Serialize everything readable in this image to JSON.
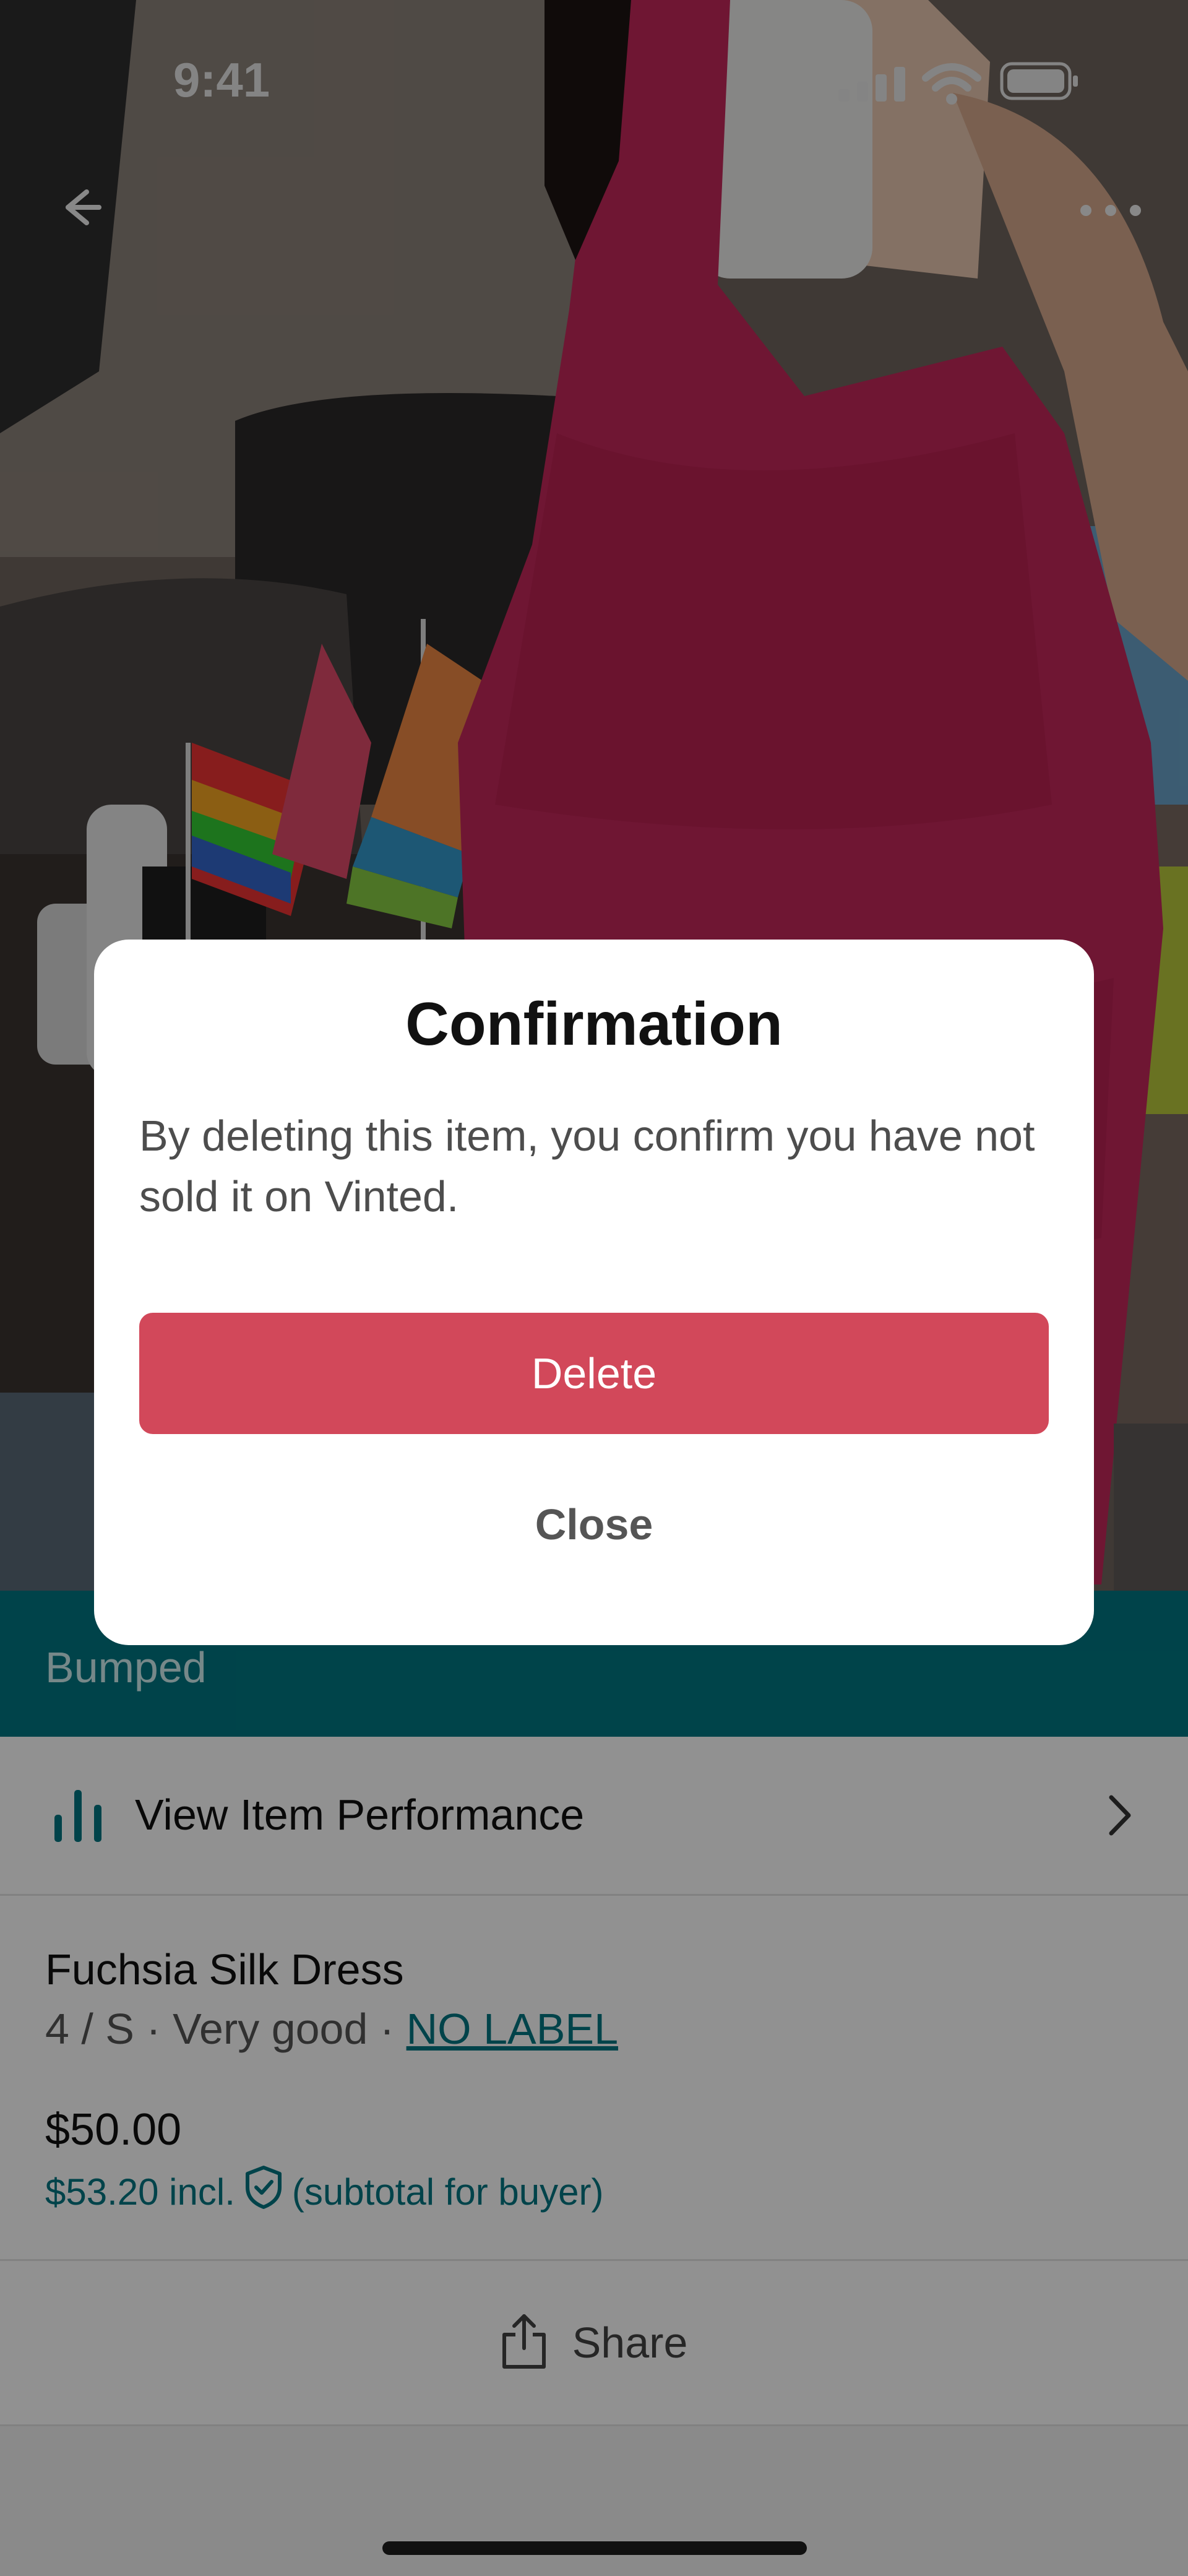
{
  "status_bar": {
    "time": "9:41"
  },
  "listing": {
    "bumped_label": "Bumped",
    "performance_label": "View Item Performance",
    "title": "Fuchsia Silk Dress",
    "details_prefix": "4 / S · Very good · ",
    "brand_link": "NO LABEL",
    "price": "$50.00",
    "buyer_price_prefix": "$53.20 incl.",
    "buyer_price_suffix": "(subtotal for buyer)",
    "share_label": "Share"
  },
  "modal": {
    "title": "Confirmation",
    "body": "By deleting this item, you confirm you have not sold it on Vinted.",
    "delete_label": "Delete",
    "close_label": "Close"
  },
  "colors": {
    "teal": "#007782",
    "delete": "#d2485a",
    "dress": "#c3275b"
  }
}
